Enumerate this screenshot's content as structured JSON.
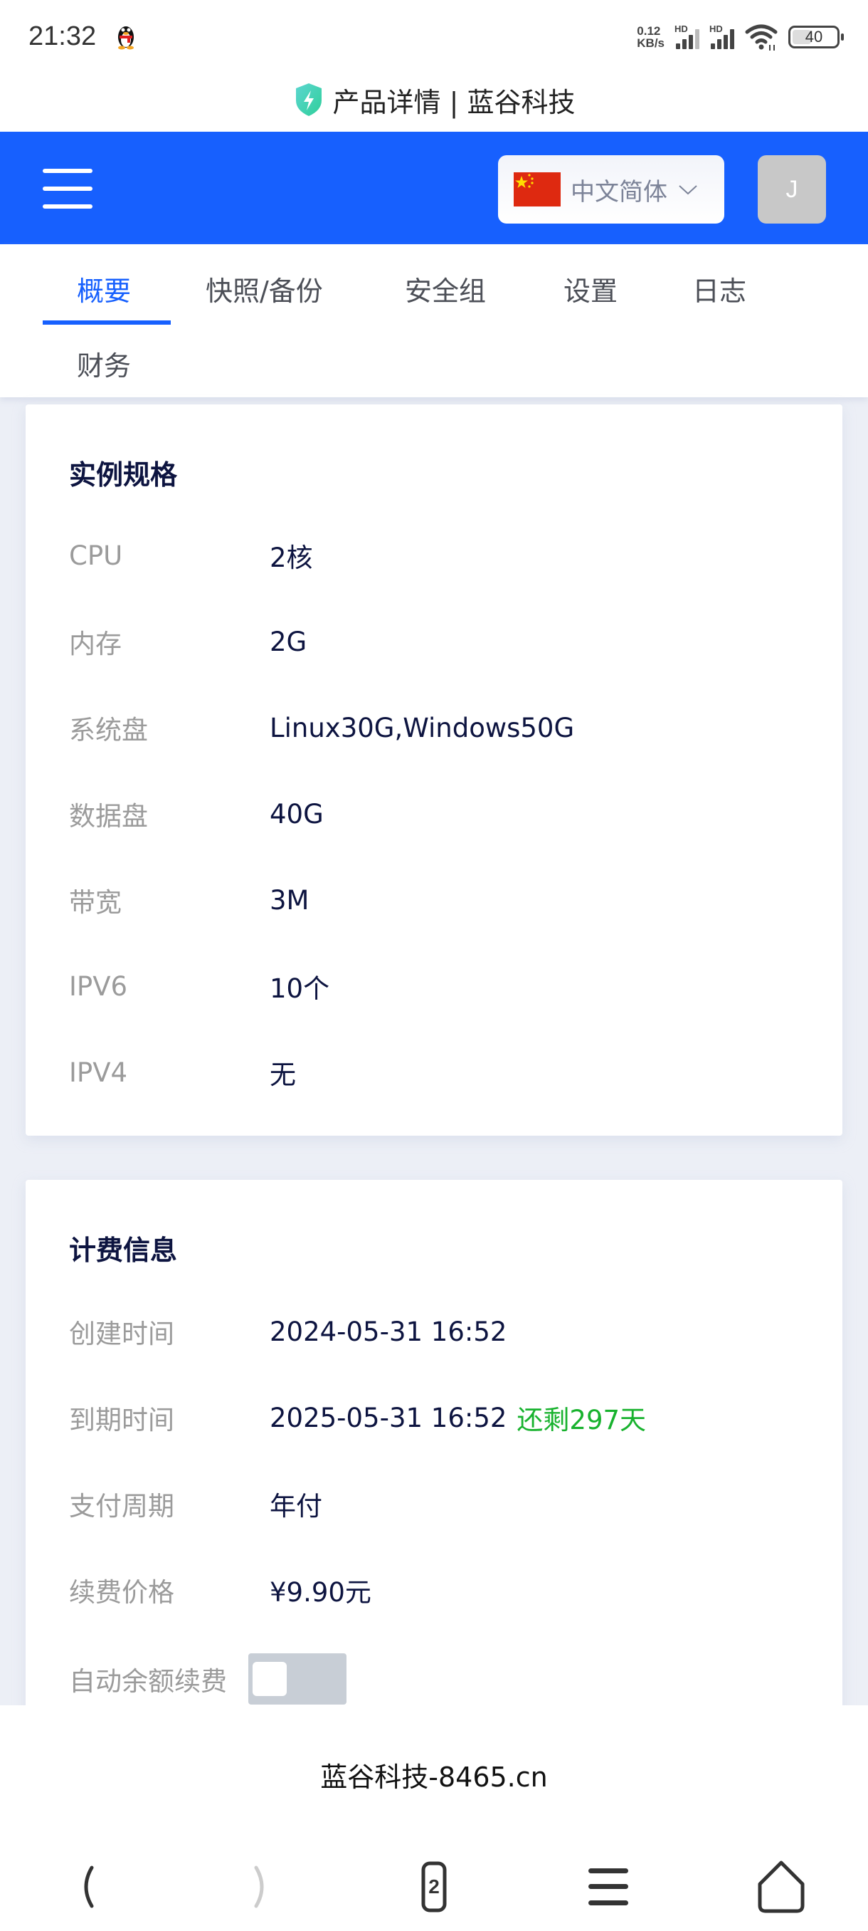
{
  "status_bar": {
    "time": "21:32",
    "net_speed_value": "0.12",
    "net_speed_unit": "KB/s",
    "sim1_label": "HD",
    "sim2_label": "HD",
    "battery_level": "40"
  },
  "page_title": "产品详情 | 蓝谷科技",
  "header": {
    "language": "中文简体",
    "avatar_initial": "J",
    "brand_color": "#1760fe"
  },
  "tabs": [
    {
      "label": "概要",
      "active": true
    },
    {
      "label": "快照/备份",
      "active": false
    },
    {
      "label": "安全组",
      "active": false
    },
    {
      "label": "设置",
      "active": false
    },
    {
      "label": "日志",
      "active": false
    },
    {
      "label": "财务",
      "active": false
    }
  ],
  "instance_spec": {
    "title": "实例规格",
    "rows": [
      {
        "label": "CPU",
        "value": "2核"
      },
      {
        "label": "内存",
        "value": "2G"
      },
      {
        "label": "系统盘",
        "value": "Linux30G,Windows50G"
      },
      {
        "label": "数据盘",
        "value": "40G"
      },
      {
        "label": "带宽",
        "value": "3M"
      },
      {
        "label": "IPV6",
        "value": "10个"
      },
      {
        "label": "IPV4",
        "value": "无"
      }
    ]
  },
  "billing": {
    "title": "计费信息",
    "created_label": "创建时间",
    "created_value": "2024-05-31 16:52",
    "expire_label": "到期时间",
    "expire_value": "2025-05-31 16:52",
    "remaining": "还剩297天",
    "cycle_label": "支付周期",
    "cycle_value": "年付",
    "price_label": "续费价格",
    "price_value": "¥9.90元",
    "auto_renew_label": "自动余额续费",
    "auto_renew_enabled": false,
    "remaining_color": "#18b22e"
  },
  "browser": {
    "domain": "蓝谷科技-8465.cn",
    "tab_count": "2"
  }
}
